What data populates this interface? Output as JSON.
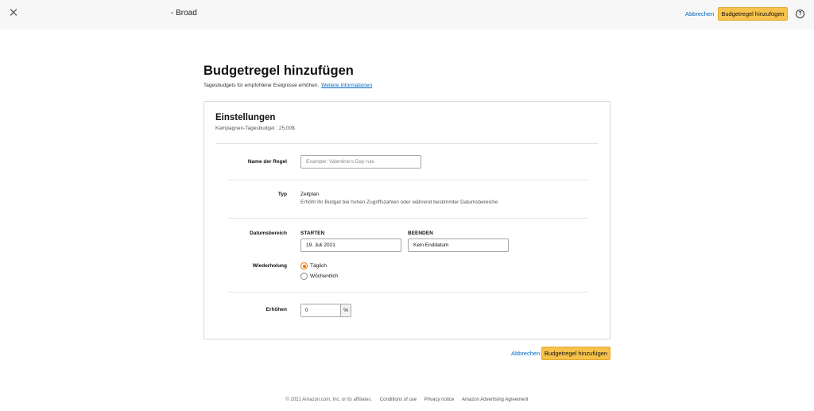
{
  "header": {
    "campaign_name": "- Broad",
    "cancel_label": "Abbrechen",
    "add_label": "Budgetregel hinzufügen",
    "close_icon": "close-icon",
    "help_icon": "help-icon"
  },
  "page": {
    "title": "Budgetregel hinzufügen",
    "subtitle": "Tagesbudgets für empfohlene Ereignisse erhöhen.",
    "more_info_link": "Weitere Informationen"
  },
  "settings": {
    "title": "Einstellungen",
    "daily_budget": "Kampagnen-Tagesbudget : 25,00$",
    "rule_name": {
      "label": "Name der Regel",
      "value": "",
      "placeholder": "Example: Valentine's Day rule"
    },
    "type": {
      "label": "Typ",
      "value": "Zeitplan",
      "description": "Erhöht Ihr Budget bei hohen Zugriffszahlen oder während bestimmter Datumsbereiche"
    },
    "date_range": {
      "label": "Datumsbereich",
      "start_label": "STARTEN",
      "start_value": "19. Juli 2021",
      "end_label": "BEENDEN",
      "end_value": "Kein Enddatum"
    },
    "recurrence": {
      "label": "Wiederholung",
      "options": [
        {
          "label": "Täglich",
          "selected": true
        },
        {
          "label": "Wöchentlich",
          "selected": false
        }
      ]
    },
    "increase": {
      "label": "Erhöhen",
      "value": "0",
      "unit": "%"
    }
  },
  "actions": {
    "cancel_label": "Abbrechen",
    "add_label": "Budgetregel hinzufügen"
  },
  "footer": {
    "copyright": "© 2021 Amazon.com, Inc. or its affiliates.",
    "links": [
      "Conditions of use",
      "Privacy notice",
      "Amazon Advertising Agreement"
    ]
  },
  "colors": {
    "primary_button": "#f7c24c",
    "link": "#0066c0",
    "radio_selected": "#e77600"
  }
}
